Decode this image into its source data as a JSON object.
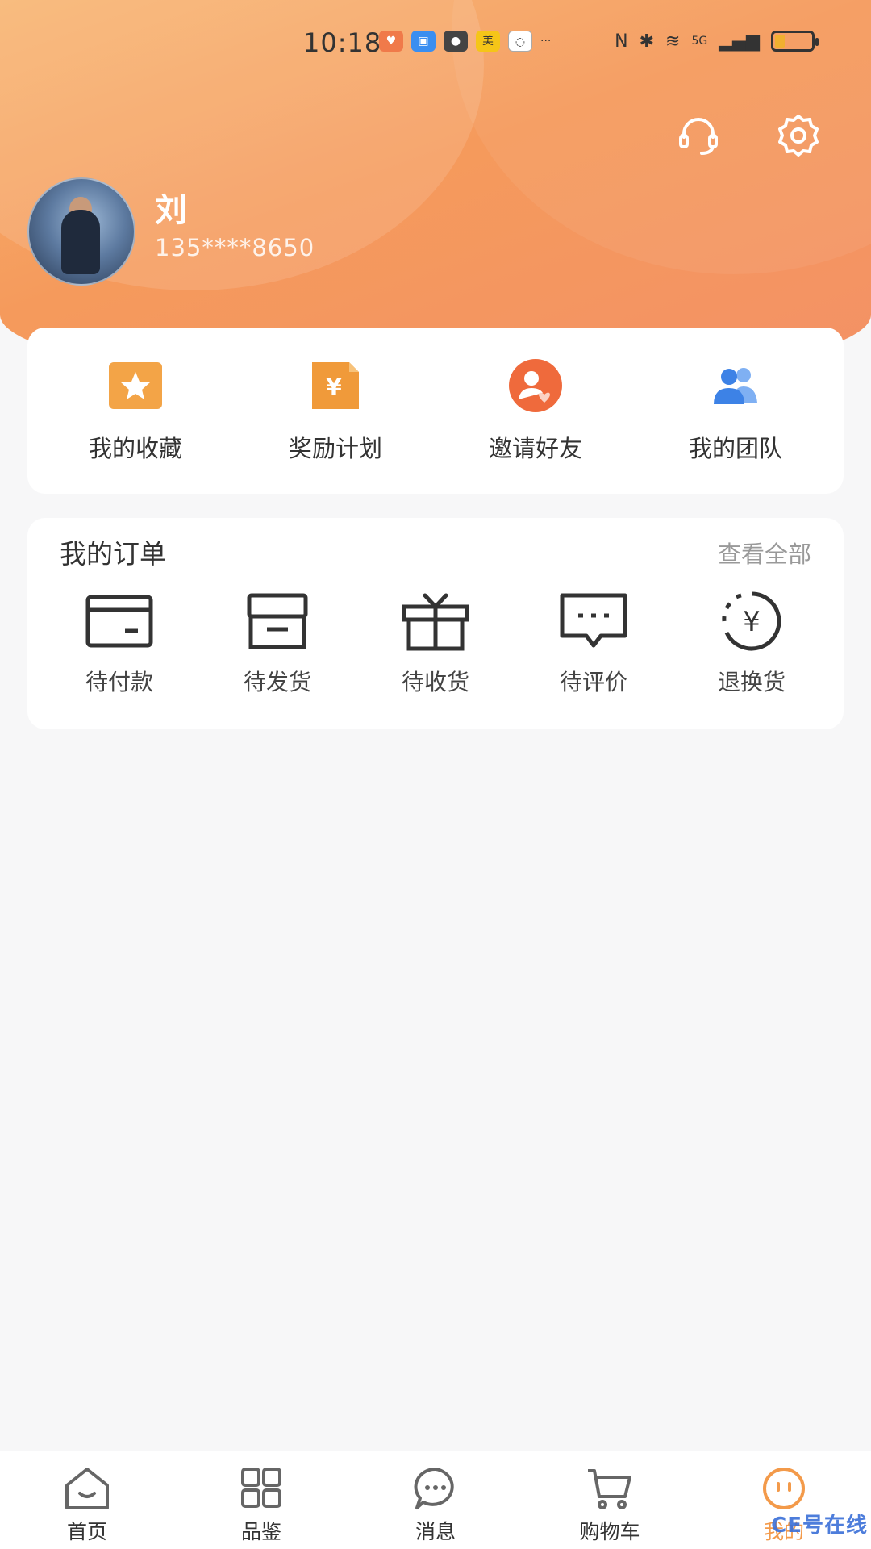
{
  "status_bar": {
    "time": "10:18",
    "more": "···",
    "network": "5G"
  },
  "header": {
    "icons": [
      "headset-icon",
      "gear-icon"
    ]
  },
  "user": {
    "name": "刘",
    "phone": "135****8650"
  },
  "quick_actions": [
    {
      "label": "我的收藏",
      "icon": "star-icon",
      "color": "#f3a447"
    },
    {
      "label": "奖励计划",
      "icon": "yuan-document-icon",
      "color": "#f09a3a"
    },
    {
      "label": "邀请好友",
      "icon": "invite-friend-icon",
      "color": "#ef6a3c"
    },
    {
      "label": "我的团队",
      "icon": "team-icon",
      "color": "#3d82e6"
    }
  ],
  "orders": {
    "title": "我的订单",
    "view_all": "查看全部",
    "items": [
      {
        "label": "待付款",
        "icon": "wallet-icon"
      },
      {
        "label": "待发货",
        "icon": "box-icon"
      },
      {
        "label": "待收货",
        "icon": "gift-icon"
      },
      {
        "label": "待评价",
        "icon": "comment-icon"
      },
      {
        "label": "退换货",
        "icon": "refund-icon"
      }
    ]
  },
  "tabbar": [
    {
      "label": "首页",
      "icon": "home-icon",
      "active": false
    },
    {
      "label": "品鉴",
      "icon": "grid-icon",
      "active": false
    },
    {
      "label": "消息",
      "icon": "message-icon",
      "active": false
    },
    {
      "label": "购物车",
      "icon": "cart-icon",
      "active": false
    },
    {
      "label": "我的",
      "icon": "profile-face-icon",
      "active": true
    }
  ],
  "colors": {
    "accent": "#f39a4a",
    "header_start": "#f7b36e",
    "header_end": "#f39166"
  },
  "watermark": "CE号在线"
}
